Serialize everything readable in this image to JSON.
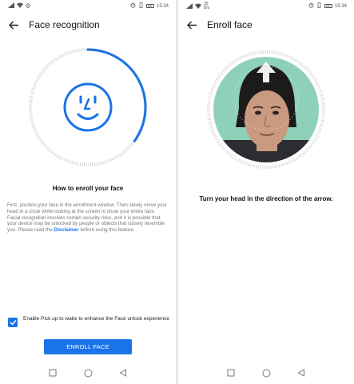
{
  "status_bar": {
    "left_network": "",
    "right_network": "35\nB/s",
    "time": "15:34"
  },
  "left_panel": {
    "title": "Face recognition",
    "heading": "How to enroll your face",
    "description_1": "First, position your face in the enrollment window. Then slowly move your head in a circle while looking at the screen to show your entire face.",
    "description_2_before": "Facial recognition involves certain security risks, and it is possible that your device may be unlocked by people or objects that closely resemble you. Please read the ",
    "disclaimer_link": "Disclaimer",
    "description_2_after": " before using this feature.",
    "checkbox_label": "Enable Pick up to wake to enhance the Face unlock experience",
    "checkbox_checked": true,
    "button_label": "ENROLL FACE",
    "accent_color": "#1a73e8",
    "progress": 0.35
  },
  "right_panel": {
    "title": "Enroll face",
    "instruction": "Turn your head in the direction of the arrow."
  },
  "navbar": {
    "icons": [
      "square-icon",
      "circle-icon",
      "triangle-back-icon"
    ]
  }
}
